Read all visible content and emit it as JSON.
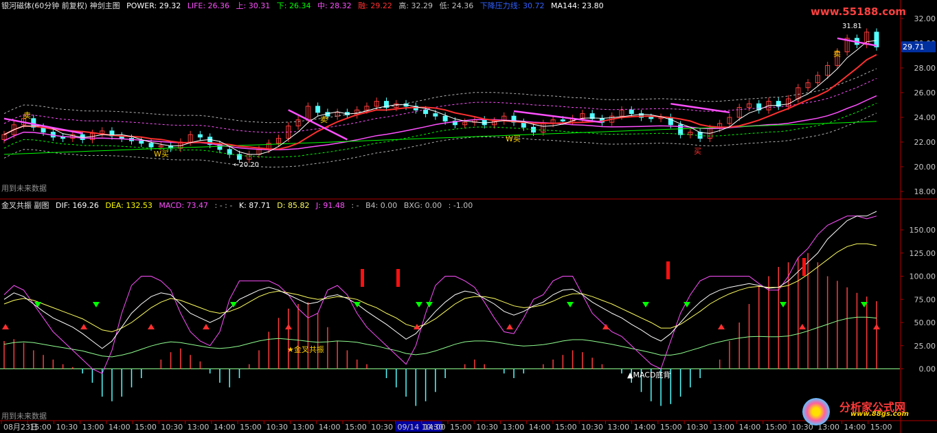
{
  "main_header": {
    "title": "银河磁体(60分钟 前复权) 神剑主图",
    "power": "POWER: 29.32",
    "life": "LIFE: 26.36",
    "up": "上: 30.31",
    "down": "下: 26.34",
    "mid": "中: 28.32",
    "rong": "融: 29.22",
    "high": "高: 32.29",
    "low": "低: 24.36",
    "pressure": "下降压力线: 30.72",
    "ma144": "MA144: 23.80"
  },
  "sub_header": {
    "title": "金叉共振 副图",
    "dif": "DIF: 169.26",
    "dea": "DEA: 132.53",
    "macd": "MACD: 73.47",
    "sep": ": - : -",
    "k": "K: 87.71",
    "d": "D: 85.82",
    "j": "J: 91.48",
    "sep2": ": -",
    "b4": "B4: 0.00",
    "bxg": "BXG: 0.00",
    "neg": ": -1.00"
  },
  "future_label_top": "用到未来数据",
  "future_label_bottom": "用到未来数据",
  "watermark_top": "www.55188.com",
  "watermark_bottom": "分析家公式网",
  "watermark_bottom_url": "www.88gs.com",
  "annotations": {
    "high_mark": "31.81",
    "low_mark": "←20.20",
    "sell1": "卖",
    "sell2": "卖",
    "sell3": "卖",
    "buy_top": "买",
    "w_buy1": "W买",
    "w_buy2": "W买",
    "golden_cross": "★金叉共振",
    "macd_div": "▲MACD底背"
  },
  "colors": {
    "power": "#ffffff",
    "life": "#ff50ff",
    "up": "#ff50ff",
    "down": "#00ff00",
    "mid": "#ff50ff",
    "rong": "#ff3030",
    "pressure": "#3060ff",
    "ma": "#ffffff",
    "up_candle": "#ff3c3c",
    "down_candle": "#54ffff",
    "axis": "#b00000",
    "k": "#ffffff",
    "d": "#ffff60",
    "j": "#ff50ff",
    "dif": "#ffffff",
    "dea": "#ffff00"
  },
  "chart_data": [
    {
      "type": "candlestick",
      "title": "银河磁体(60分钟 前复权) 神剑主图",
      "ylim": [
        17.5,
        32.5
      ],
      "y_ticks": [
        "32.00",
        "30.00",
        "28.00",
        "26.00",
        "24.00",
        "22.00",
        "20.00",
        "18.00"
      ],
      "y_tick_values": [
        32,
        30,
        28,
        26,
        24,
        22,
        20,
        18
      ],
      "price_marker": "29.71",
      "price_marker_value": 29.71,
      "close": [
        22.6,
        23.4,
        23.9,
        23.2,
        22.8,
        22.4,
        22.3,
        22.6,
        22.2,
        22.7,
        22.9,
        22.5,
        22.3,
        22.1,
        21.9,
        21.6,
        21.7,
        21.5,
        22.0,
        22.6,
        22.4,
        21.8,
        21.4,
        21.0,
        20.6,
        21.0,
        21.4,
        21.9,
        22.3,
        23.3,
        23.8,
        24.9,
        24.4,
        24.1,
        24.4,
        24.2,
        24.6,
        24.9,
        25.3,
        24.8,
        25.1,
        24.9,
        24.6,
        24.3,
        24.1,
        23.7,
        23.4,
        23.6,
        23.8,
        23.4,
        23.7,
        24.1,
        23.6,
        23.2,
        22.8,
        23.5,
        23.8,
        23.7,
        23.9,
        24.3,
        23.9,
        23.6,
        24.1,
        24.6,
        24.3,
        24.0,
        23.9,
        24.0,
        23.4,
        22.6,
        22.8,
        22.3,
        23.1,
        23.5,
        24.0,
        24.8,
        25.1,
        24.6,
        25.3,
        24.9,
        25.5,
        26.4,
        26.8,
        27.4,
        28.2,
        29.3,
        30.4,
        29.9,
        30.9,
        29.7
      ],
      "dates": [
        "08月23日",
        "15:00",
        "10:30",
        "13:00",
        "14:00",
        "15:00",
        "10:30",
        "13:00",
        "14:00",
        "15:00",
        "10:30",
        "13:00",
        "14:00",
        "15:00",
        "10:30",
        "09/14 10:30",
        "14:00",
        "15:00",
        "10:30",
        "13:00",
        "14:00",
        "15:00",
        "10:30",
        "13:00",
        "14:00",
        "15:00",
        "10:30",
        "13:00",
        "14:00",
        "15:00",
        "10:30",
        "13:00",
        "14:00",
        "15:00"
      ],
      "series": [
        {
          "name": "POWER",
          "last": 29.32
        },
        {
          "name": "LIFE",
          "last": 26.36
        },
        {
          "name": "上",
          "last": 30.31
        },
        {
          "name": "下",
          "last": 26.34
        },
        {
          "name": "中",
          "last": 28.32
        },
        {
          "name": "融",
          "last": 29.22
        },
        {
          "name": "下降压力线",
          "last": 30.72
        },
        {
          "name": "MA144",
          "last": 23.8
        }
      ]
    },
    {
      "type": "line",
      "title": "金叉共振 副图",
      "ylim": [
        -50,
        170
      ],
      "y_ticks": [
        "150.00",
        "125.00",
        "100.00",
        "75.00",
        "50.00",
        "25.00",
        "0.00"
      ],
      "y_tick_values": [
        150,
        125,
        100,
        75,
        50,
        25,
        0
      ],
      "series": [
        {
          "name": "K",
          "values": [
            75,
            82,
            78,
            70,
            62,
            55,
            50,
            45,
            38,
            30,
            22,
            30,
            45,
            60,
            70,
            78,
            82,
            80,
            70,
            60,
            55,
            50,
            55,
            65,
            75,
            80,
            85,
            88,
            85,
            80,
            75,
            70,
            72,
            78,
            80,
            76,
            70,
            62,
            55,
            48,
            40,
            32,
            38,
            50,
            62,
            72,
            80,
            84,
            82,
            76,
            70,
            62,
            58,
            62,
            68,
            72,
            80,
            85,
            86,
            80,
            72,
            66,
            60,
            55,
            48,
            42,
            35,
            30,
            38,
            50,
            62,
            72,
            80,
            85,
            88,
            90,
            92,
            90,
            87,
            88,
            95,
            105,
            115,
            125,
            140,
            150,
            160,
            165,
            165,
            170
          ]
        },
        {
          "name": "D",
          "values": [
            70,
            74,
            76,
            74,
            70,
            66,
            62,
            58,
            54,
            48,
            42,
            40,
            44,
            50,
            58,
            66,
            72,
            76,
            74,
            70,
            66,
            62,
            60,
            62,
            66,
            72,
            78,
            82,
            84,
            82,
            80,
            77,
            75,
            76,
            78,
            77,
            75,
            70,
            66,
            60,
            55,
            48,
            45,
            48,
            54,
            62,
            70,
            76,
            78,
            78,
            76,
            72,
            68,
            66,
            67,
            69,
            73,
            78,
            81,
            81,
            78,
            74,
            70,
            65,
            60,
            55,
            50,
            44,
            44,
            48,
            55,
            62,
            70,
            76,
            81,
            85,
            88,
            89,
            88,
            88,
            90,
            95,
            102,
            110,
            118,
            126,
            132,
            135,
            135,
            133
          ]
        },
        {
          "name": "J",
          "values": [
            80,
            90,
            85,
            70,
            55,
            40,
            30,
            20,
            10,
            0,
            -5,
            20,
            60,
            90,
            100,
            100,
            95,
            85,
            60,
            40,
            30,
            25,
            40,
            75,
            95,
            95,
            95,
            95,
            90,
            80,
            65,
            55,
            60,
            85,
            90,
            80,
            60,
            45,
            35,
            25,
            15,
            5,
            25,
            60,
            90,
            100,
            100,
            95,
            88,
            72,
            55,
            40,
            38,
            55,
            75,
            80,
            95,
            100,
            100,
            80,
            60,
            50,
            40,
            35,
            25,
            15,
            5,
            0,
            30,
            60,
            80,
            95,
            100,
            100,
            100,
            100,
            100,
            92,
            85,
            85,
            100,
            120,
            130,
            145,
            155,
            160,
            165,
            165,
            162,
            165
          ]
        }
      ],
      "macd_bars": [
        30,
        32,
        28,
        20,
        15,
        10,
        5,
        2,
        -5,
        -15,
        -30,
        -35,
        -30,
        -20,
        -10,
        0,
        10,
        18,
        22,
        15,
        8,
        -5,
        -15,
        -20,
        -10,
        5,
        20,
        40,
        55,
        65,
        70,
        72,
        60,
        45,
        30,
        20,
        10,
        5,
        0,
        -10,
        -20,
        -30,
        -40,
        -35,
        -25,
        -10,
        0,
        5,
        10,
        5,
        0,
        -5,
        -10,
        -5,
        0,
        5,
        10,
        15,
        20,
        18,
        12,
        5,
        0,
        -5,
        -15,
        -25,
        -35,
        -40,
        -38,
        -30,
        -20,
        -10,
        0,
        10,
        30,
        50,
        70,
        90,
        100,
        110,
        115,
        120,
        125,
        115,
        100,
        95,
        88,
        82,
        78,
        73
      ]
    }
  ]
}
